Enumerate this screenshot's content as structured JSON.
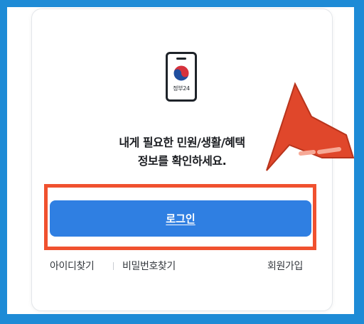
{
  "brand": {
    "name": "정부24"
  },
  "headline": {
    "line1": "내게 필요한 민원/생활/혜택",
    "line2": "정보를 확인하세요."
  },
  "login_button": {
    "label": "로그인"
  },
  "links": {
    "find_id": "아이디찾기",
    "find_password": "비밀번호찾기",
    "sign_up": "회원가입"
  },
  "colors": {
    "page_border": "#1E8BD6",
    "button": "#2F7FE2",
    "highlight": "#F0512F"
  },
  "icons": [
    "phone-emblem-icon",
    "arrow-pointer-icon"
  ]
}
